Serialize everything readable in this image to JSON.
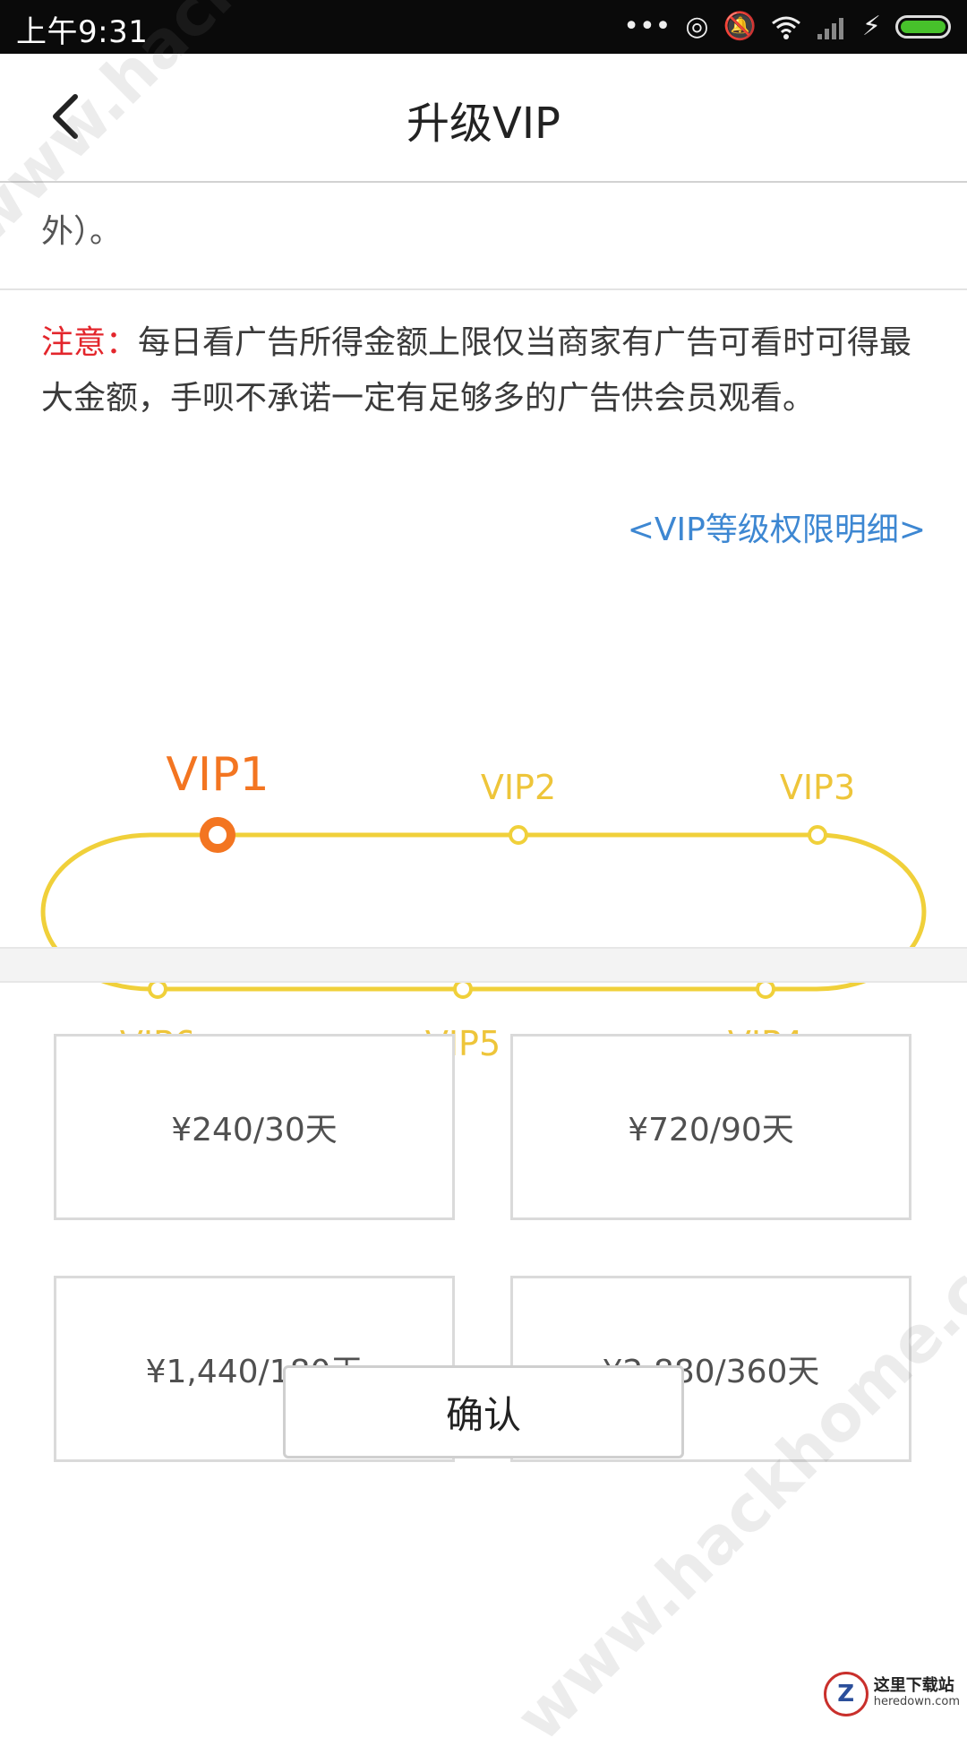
{
  "status_bar": {
    "time": "上午9:31"
  },
  "header": {
    "title": "升级VIP"
  },
  "content": {
    "partial_desc_line": "外）。",
    "notice_label": "注意：",
    "notice_text": "每日看广告所得金额上限仅当商家有广告可看时可得最大金额，手呗不承诺一定有足够多的广告供会员观看。",
    "vip_detail_link": "<VIP等级权限明细>"
  },
  "vip_levels": {
    "current": "VIP1",
    "labels": [
      "VIP1",
      "VIP2",
      "VIP3",
      "VIP4",
      "VIP5",
      "VIP6"
    ],
    "colors": {
      "track": "#f0d03a",
      "current": "#f37521",
      "label": "#eec53a"
    }
  },
  "plans": [
    {
      "label": "¥240/30天"
    },
    {
      "label": "¥720/90天"
    },
    {
      "label": "¥1,440/180天"
    },
    {
      "label": "¥2,880/360天"
    }
  ],
  "confirm_label": "确认",
  "watermarks": {
    "text": "www.hackhome.com",
    "corner_logo_line1": "这里下载站",
    "corner_logo_line2": "heredown.com"
  }
}
